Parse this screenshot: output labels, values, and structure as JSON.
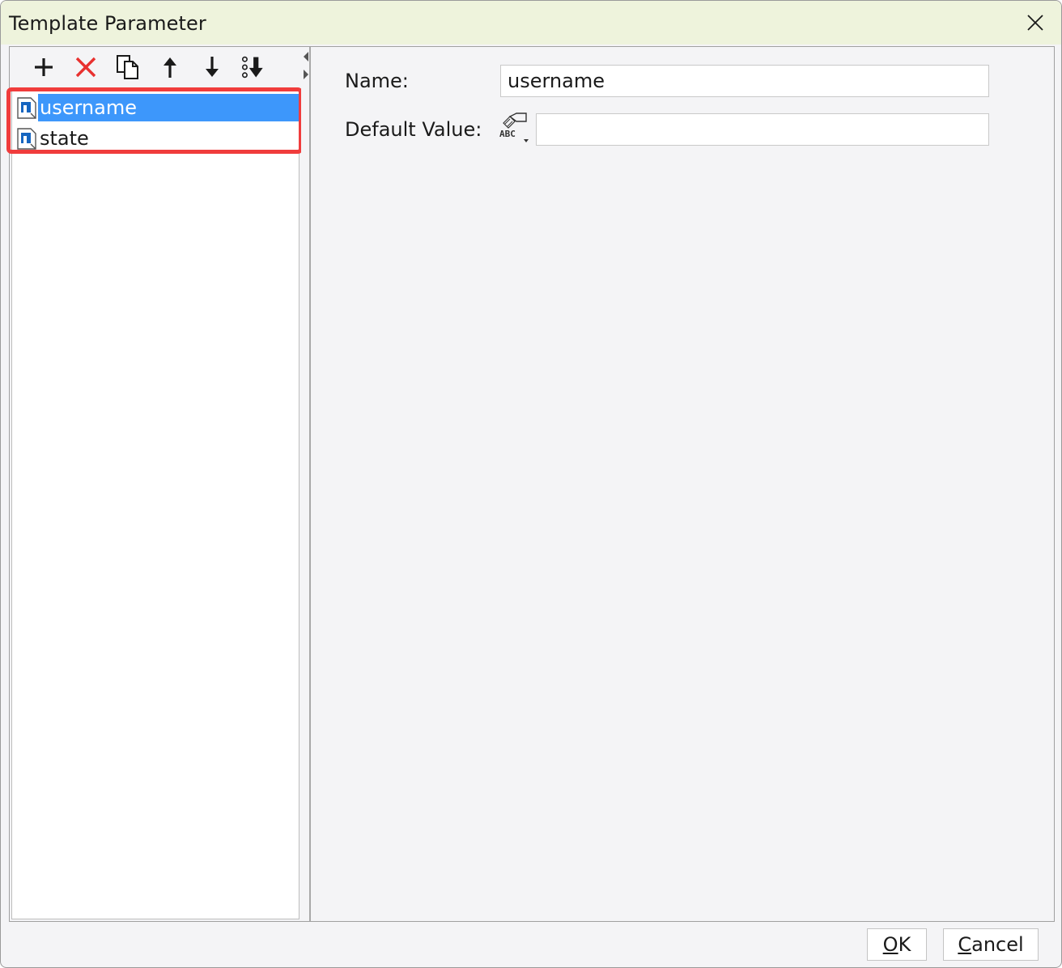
{
  "window": {
    "title": "Template Parameter"
  },
  "toolbar": {
    "buttons": [
      {
        "name": "add",
        "icon": "plus-icon"
      },
      {
        "name": "delete",
        "icon": "x-icon",
        "color": "#e8312f"
      },
      {
        "name": "copy",
        "icon": "copy-icon"
      },
      {
        "name": "move-up",
        "icon": "arrow-up-icon"
      },
      {
        "name": "move-down",
        "icon": "arrow-down-icon"
      },
      {
        "name": "sort",
        "icon": "sort-icon"
      }
    ]
  },
  "parameters": {
    "items": [
      {
        "label": "username",
        "selected": true
      },
      {
        "label": "state",
        "selected": false
      }
    ]
  },
  "form": {
    "name_label": "Name:",
    "name_value": "username",
    "default_label": "Default Value:",
    "default_value": "",
    "type_icon_text": "ABC"
  },
  "footer": {
    "ok_mnemonic": "O",
    "ok_rest": "K",
    "cancel_mnemonic": "C",
    "cancel_rest": "ancel"
  },
  "colors": {
    "selection": "#3d97fb",
    "highlight": "#f03c3c",
    "titlebar": "#eef3dc"
  }
}
